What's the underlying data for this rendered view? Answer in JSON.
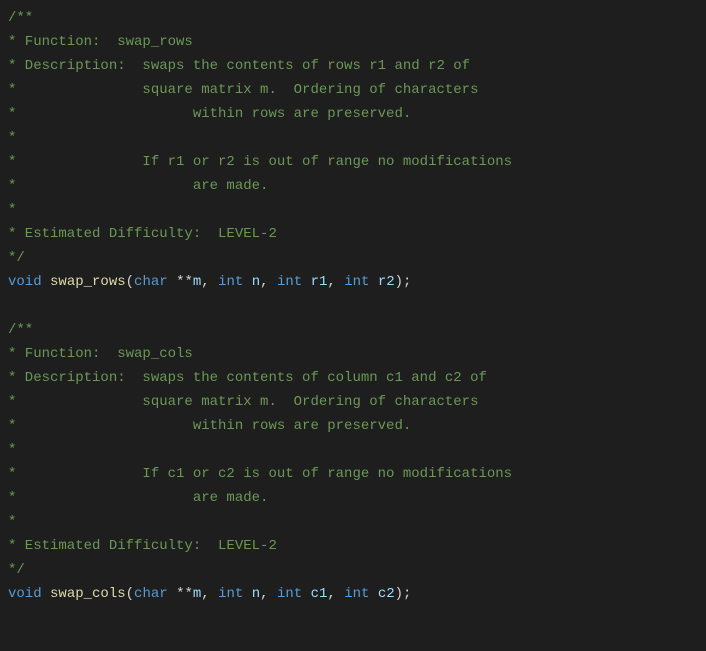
{
  "blocks": [
    {
      "comment_lines": [
        "/**",
        "* Function:  swap_rows",
        "* Description:  swaps the contents of rows r1 and r2 of ",
        "*               square matrix m.  Ordering of characters",
        "*                     within rows are preserved.",
        "*",
        "*               If r1 or r2 is out of range no modifications",
        "*                     are made.",
        "*",
        "* Estimated Difficulty:  LEVEL-2",
        "*/"
      ],
      "sig": {
        "kw_void": "void",
        "sp1": " ",
        "fn": "swap_rows",
        "open": "(",
        "kw_char": "char",
        "sp2": " ",
        "stars": "**",
        "p1": "m",
        "c1": ", ",
        "kw_int1": "int",
        "sp3": " ",
        "p2": "n",
        "c2": ", ",
        "kw_int2": "int",
        "sp4": " ",
        "p3": "r1",
        "c3": ", ",
        "kw_int3": "int",
        "sp5": " ",
        "p4": "r2",
        "close": ");"
      }
    },
    {
      "comment_lines": [
        "/**",
        "* Function:  swap_cols",
        "* Description:  swaps the contents of column c1 and c2 of ",
        "*               square matrix m.  Ordering of characters",
        "*                     within rows are preserved.",
        "*",
        "*               If c1 or c2 is out of range no modifications",
        "*                     are made.",
        "*",
        "* Estimated Difficulty:  LEVEL-2",
        "*/"
      ],
      "sig": {
        "kw_void": "void",
        "sp1": " ",
        "fn": "swap_cols",
        "open": "(",
        "kw_char": "char",
        "sp2": " ",
        "stars": "**",
        "p1": "m",
        "c1": ", ",
        "kw_int1": "int",
        "sp3": " ",
        "p2": "n",
        "c2": ", ",
        "kw_int2": "int",
        "sp4": " ",
        "p3": "c1",
        "c3": ", ",
        "kw_int3": "int",
        "sp5": " ",
        "p4": "c2",
        "close": ");"
      }
    }
  ]
}
